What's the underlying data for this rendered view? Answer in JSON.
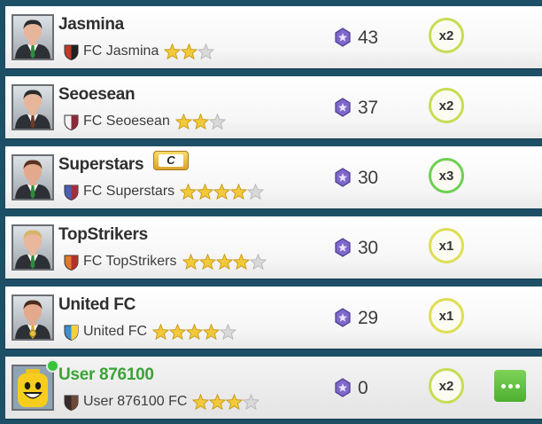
{
  "colors": {
    "background": "#1d4f66",
    "user_name": "#3aa336",
    "online": "#37c43a",
    "gem": "#7f68c9",
    "star": "#f1c93a",
    "star_empty": "#d9d9d9",
    "more_button": "#5fbd3e"
  },
  "leaderboard": {
    "rows": [
      {
        "name": "Jasmina",
        "club": "FC Jasmina",
        "stars": 2,
        "stars_total": 3,
        "points": "43",
        "multiplier": "x2",
        "avatar": "man-suit-green-tie-icon",
        "crest": "shield-red-black-icon",
        "crest_colors": [
          "#c0392b",
          "#222222"
        ],
        "hair": "#2b2b2b",
        "tie": "#2e8b3e",
        "skin": "#e6b59a"
      },
      {
        "name": "Seoesean",
        "club": "FC Seoesean",
        "stars": 2,
        "stars_total": 3,
        "points": "37",
        "multiplier": "x2",
        "avatar": "man-suit-brown-tie-icon",
        "crest": "shield-white-maroon-icon",
        "crest_colors": [
          "#f4f4f4",
          "#8b2c3b"
        ],
        "hair": "#2b2b2b",
        "tie": "#6b3a2a",
        "skin": "#e6b59a"
      },
      {
        "name": "Superstars",
        "badge": "C",
        "club": "FC Superstars",
        "stars": 4,
        "stars_total": 5,
        "points": "30",
        "multiplier": "x3",
        "avatar": "man-suit-green-tie-icon",
        "crest": "shield-blue-maroon-icon",
        "crest_colors": [
          "#4a5fb5",
          "#a1303f"
        ],
        "hair": "#5a3322",
        "tie": "#2e8b3e",
        "skin": "#e3a98c"
      },
      {
        "name": "TopStrikers",
        "club": "FC TopStrikers",
        "stars": 4,
        "stars_total": 5,
        "points": "30",
        "multiplier": "x1",
        "avatar": "man-suit-green-tie-blond-icon",
        "crest": "shield-orange-red-icon",
        "crest_colors": [
          "#e07a2c",
          "#b5302a"
        ],
        "hair": "#d8b36a",
        "tie": "#2e8b3e",
        "skin": "#e8b79c"
      },
      {
        "name": "United FC",
        "club": "United FC",
        "stars": 4,
        "stars_total": 5,
        "points": "29",
        "multiplier": "x1",
        "avatar": "man-suit-medal-icon",
        "crest": "shield-blue-yellow-icon",
        "crest_colors": [
          "#3b8fd8",
          "#f4d03f"
        ],
        "hair": "#4a2c1e",
        "tie": "#d4aa37",
        "skin": "#e3a98c"
      },
      {
        "name": "User 876100",
        "club": "User 876100 FC",
        "stars": 3,
        "stars_total": 4,
        "points": "0",
        "multiplier": "x2",
        "avatar": "lego-face-icon",
        "crest": "shield-dark-icon",
        "crest_colors": [
          "#3a2a2a",
          "#6b4a3a"
        ],
        "is_user": true,
        "online": true,
        "more_button": "more-options-icon"
      }
    ]
  }
}
